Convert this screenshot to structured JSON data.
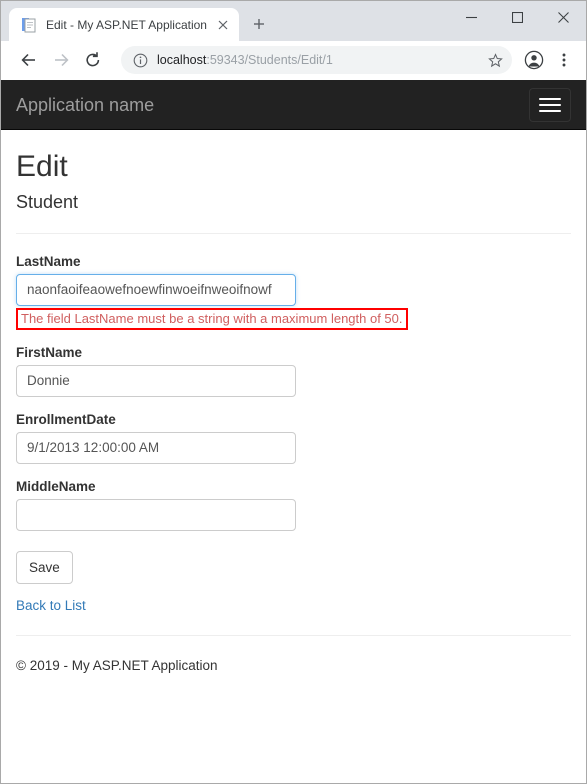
{
  "browser": {
    "tab": {
      "title": "Edit - My ASP.NET Application",
      "favicon_icon": "page-icon",
      "close_icon": "close-icon"
    },
    "new_tab_icon": "plus-icon",
    "window_controls": {
      "minimize_icon": "minimize-icon",
      "maximize_icon": "maximize-icon",
      "close_icon": "close-icon"
    },
    "toolbar": {
      "back_icon": "arrow-left-icon",
      "forward_icon": "arrow-right-icon",
      "reload_icon": "reload-icon",
      "info_icon": "info-circle-icon",
      "star_icon": "star-icon",
      "profile_icon": "profile-avatar-icon",
      "menu_icon": "three-dots-menu-icon",
      "url_host": "localhost",
      "url_rest": ":59343/Students/Edit/1"
    }
  },
  "page": {
    "navbar": {
      "brand": "Application name",
      "toggle_icon": "hamburger-menu-icon"
    },
    "title": "Edit",
    "subtitle": "Student",
    "form": {
      "fields": [
        {
          "label": "LastName",
          "value": "naonfaoifeaowefnoewfinwoeifnweoifnowf",
          "error": "The field LastName must be a string with a maximum length of 50."
        },
        {
          "label": "FirstName",
          "value": "Donnie",
          "error": ""
        },
        {
          "label": "EnrollmentDate",
          "value": "9/1/2013 12:00:00 AM",
          "error": ""
        },
        {
          "label": "MiddleName",
          "value": "",
          "error": ""
        }
      ],
      "submit_label": "Save"
    },
    "back_link": "Back to List",
    "footer": "© 2019 - My ASP.NET Application"
  },
  "colors": {
    "navbar_bg": "#222222",
    "brand_text": "#9d9d9d",
    "link": "#337ab7",
    "error_border": "#ff0000",
    "error_text": "#d05f5f",
    "input_focus_border": "#66afe9"
  }
}
